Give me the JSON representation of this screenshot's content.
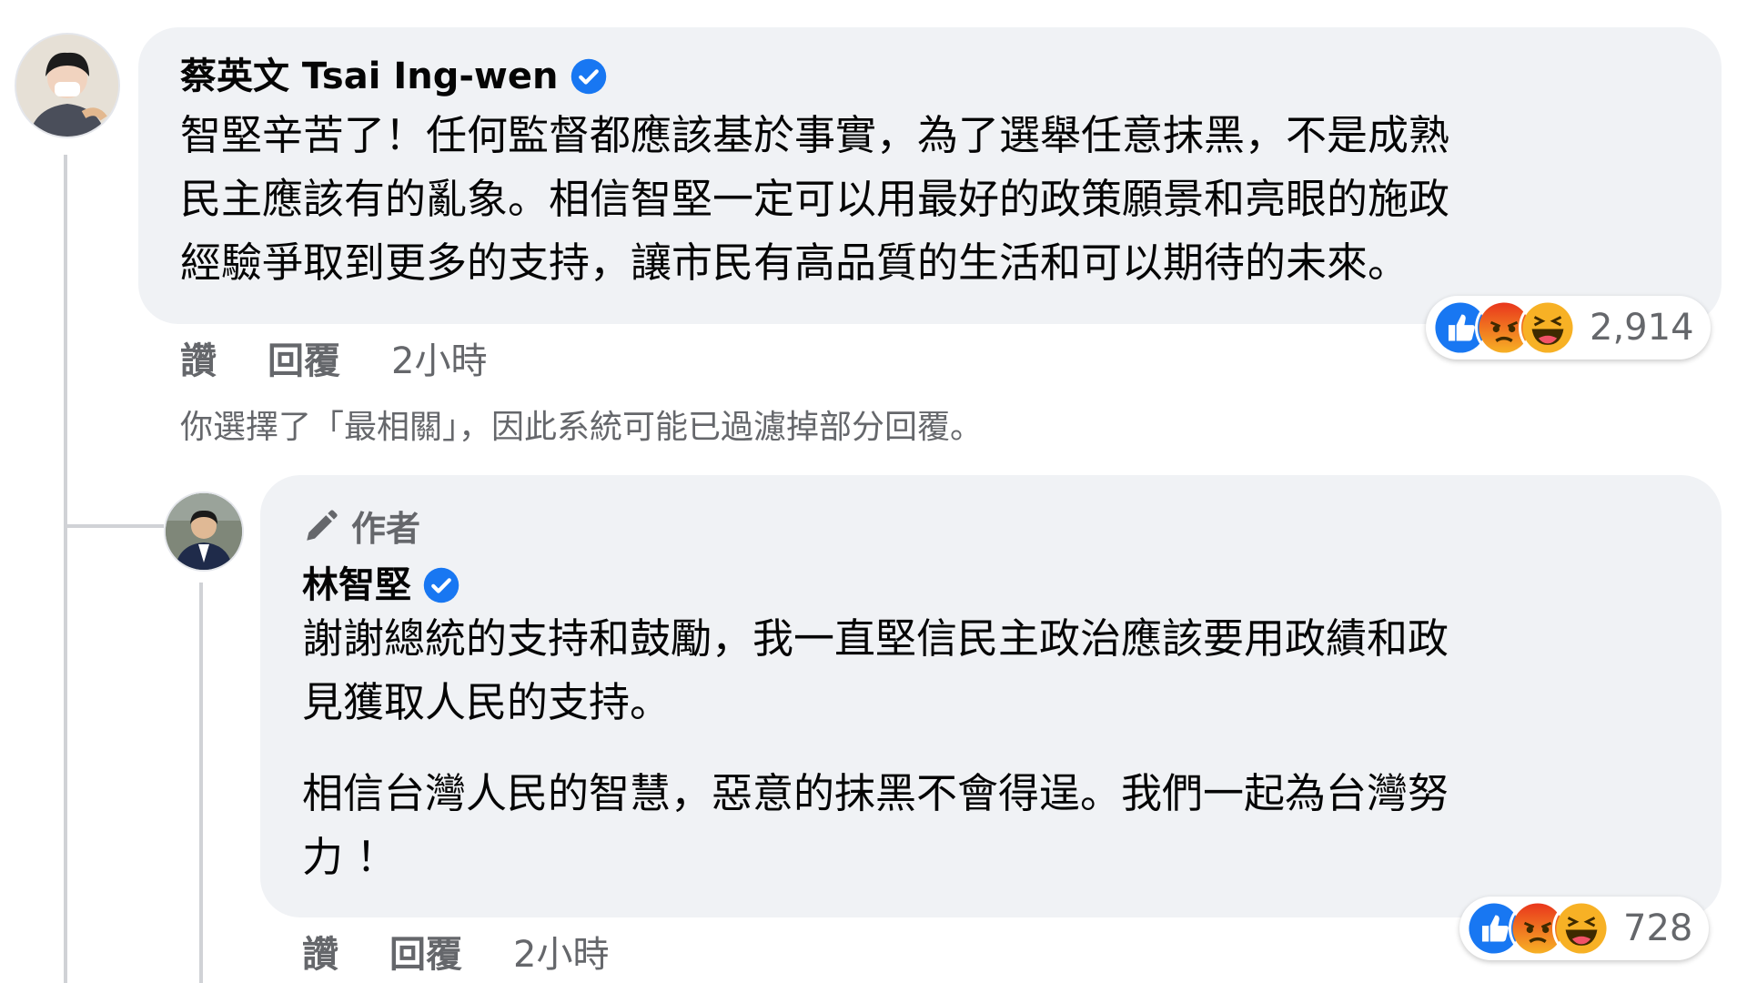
{
  "comment": {
    "author": "蔡英文 Tsai Ing-wen",
    "lines": [
      "智堅辛苦了！任何監督都應該基於事實，為了選舉任意抹黑，不是成熟",
      "民主應該有的亂象。相信智堅一定可以用最好的政策願景和亮眼的施政",
      "經驗爭取到更多的支持，讓市民有高品質的生活和可以期待的未來。"
    ],
    "reaction_count": "2,914",
    "actions": {
      "like": "讚",
      "reply": "回覆",
      "time": "2小時"
    }
  },
  "filter_note": "你選擇了「最相關」，因此系統可能已過濾掉部分回覆。",
  "reply": {
    "badge": "作者",
    "author": "林智堅",
    "paragraph1": [
      "謝謝總統的支持和鼓勵，我一直堅信民主政治應該要用政績和政",
      "見獲取人民的支持。"
    ],
    "paragraph2": [
      "相信台灣人民的智慧，惡意的抹黑不會得逞。我們一起為台灣努",
      "力 ！"
    ],
    "reaction_count": "728",
    "actions": {
      "like": "讚",
      "reply": "回覆",
      "time": "2小時"
    }
  },
  "colors": {
    "bubble": "#f0f2f5",
    "secondary_text": "#65676b",
    "verified_blue": "#1877f2",
    "like_blue": "#1877f2",
    "angry_orange": "#f0622b",
    "haha_yellow": "#f7b125"
  },
  "icons": {
    "verified": "verified-badge-icon",
    "pencil": "pencil-icon",
    "reactions": [
      "like-reaction-icon",
      "angry-reaction-icon",
      "haha-reaction-icon"
    ]
  }
}
